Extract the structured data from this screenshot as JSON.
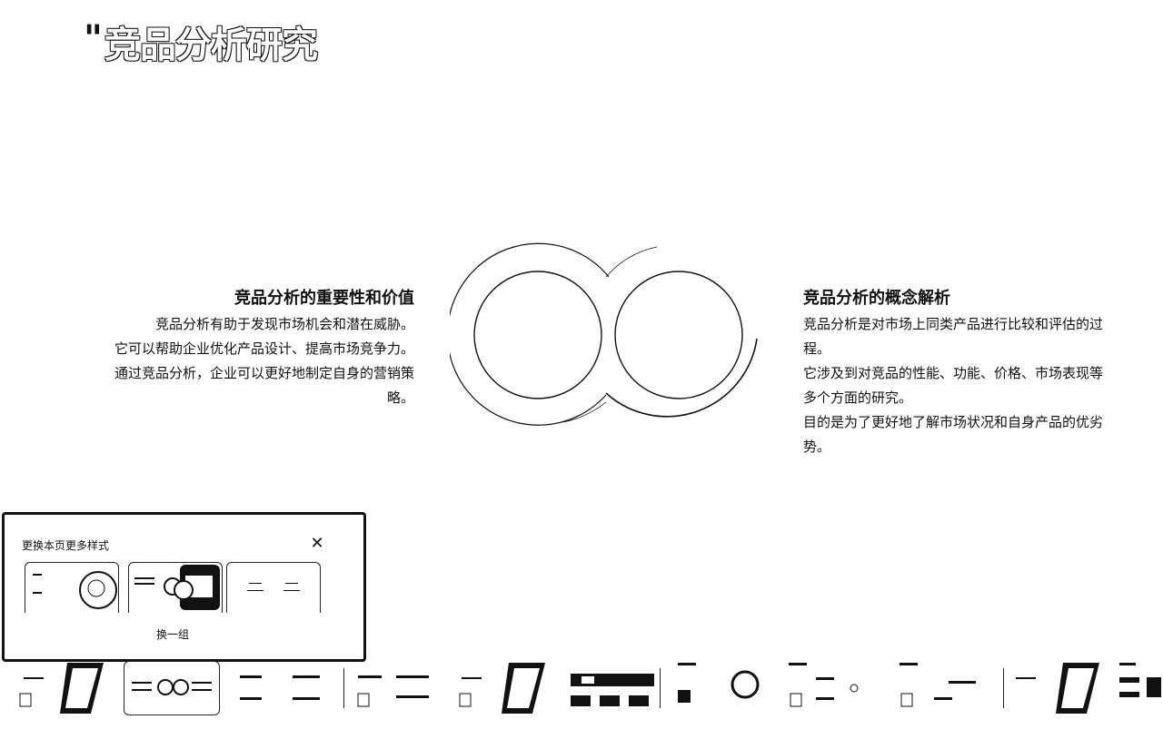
{
  "slide": {
    "title": "竞品分析研究",
    "quote_mark": "\""
  },
  "left_block": {
    "heading": "竞品分析的重要性和价值",
    "paragraphs": [
      "竞品分析有助于发现市场机会和潜在威胁。",
      "它可以帮助企业优化产品设计、提高市场竞争力。",
      "通过竞品分析，企业可以更好地制定自身的营销策略。"
    ]
  },
  "right_block": {
    "heading": "竞品分析的概念解析",
    "paragraphs": [
      "竞品分析是对市场上同类产品进行比较和评估的过程。",
      "它涉及到对竞品的性能、功能、价格、市场表现等多个方面的研究。",
      "目的是为了更好地了解市场状况和自身产品的优劣势。"
    ]
  },
  "style_panel": {
    "title": "更换本页更多样式",
    "close_icon": "close-icon",
    "refresh_label": "换一组"
  }
}
